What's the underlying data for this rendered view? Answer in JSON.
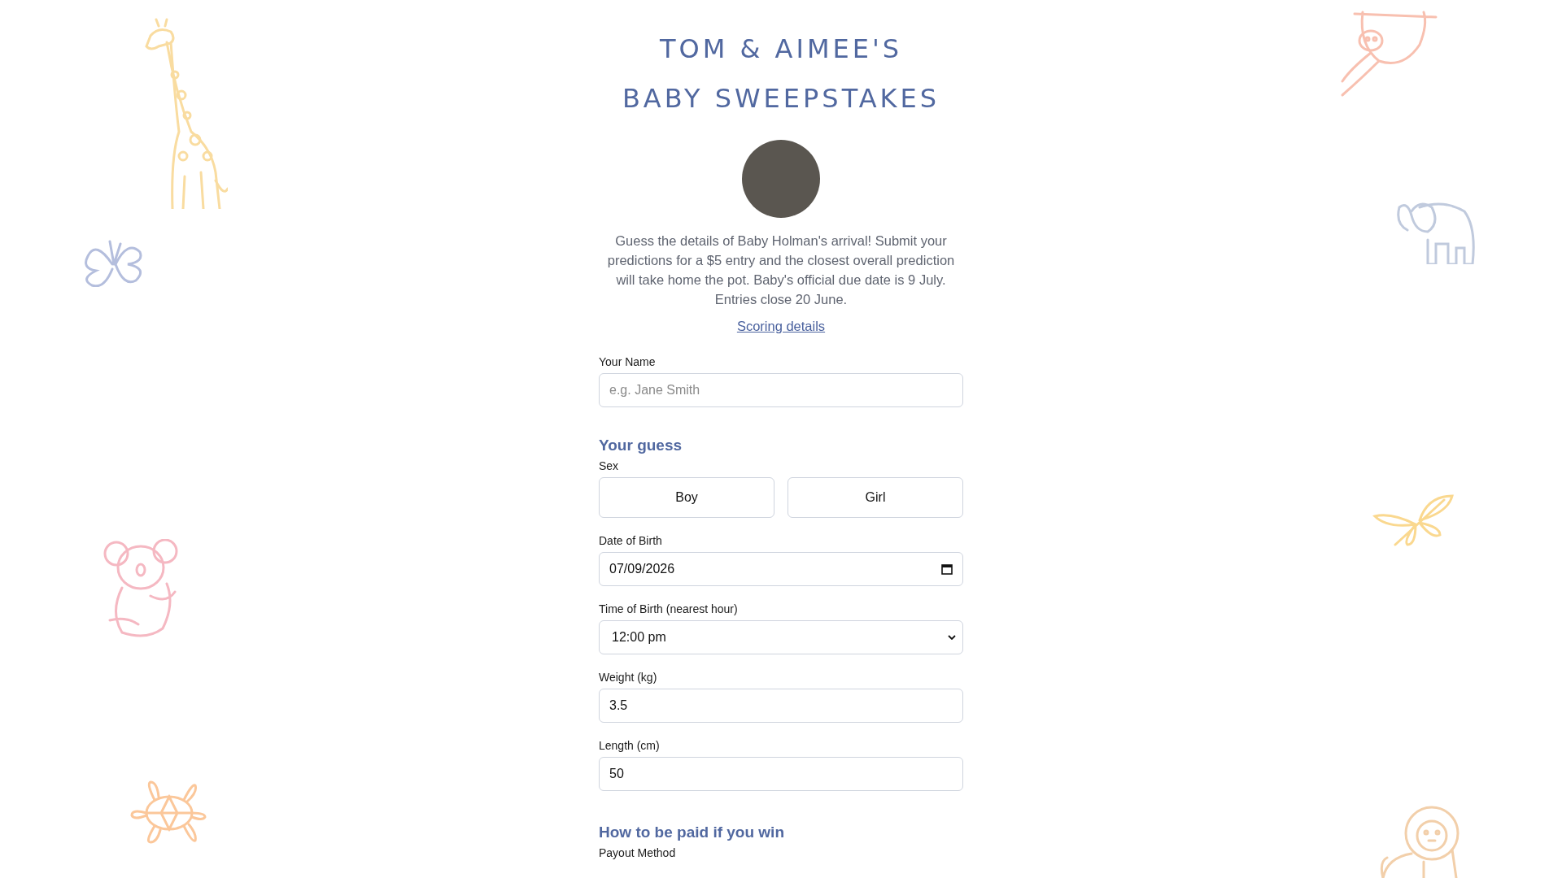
{
  "title_lines": [
    "TOM & AIMEE'S",
    "BABY SWEEPSTAKES"
  ],
  "intro": "Guess the details of Baby Holman's arrival! Submit your predictions for a $5 entry and the closest overall prediction will take home the pot. Baby's official due date is 9 July. Entries close 20 June.",
  "scoring_link": "Scoring details",
  "name_field": {
    "label": "Your Name",
    "placeholder": "e.g. Jane Smith"
  },
  "guess_section": {
    "heading": "Your guess",
    "sex": {
      "label": "Sex",
      "options": [
        {
          "label": "Boy",
          "selected": false
        },
        {
          "label": "Girl",
          "selected": false
        }
      ]
    },
    "fields": [
      {
        "kind": "date",
        "label": "Date of Birth",
        "value": "07/09/2026"
      },
      {
        "kind": "select",
        "label": "Time of Birth (nearest hour)",
        "value": "12:00 pm"
      },
      {
        "kind": "text",
        "label": "Weight (kg)",
        "value": "3.5"
      },
      {
        "kind": "text",
        "label": "Length (cm)",
        "value": "50"
      }
    ]
  },
  "payout_section": {
    "heading": "How to be paid if you win",
    "label": "Payout Method"
  }
}
